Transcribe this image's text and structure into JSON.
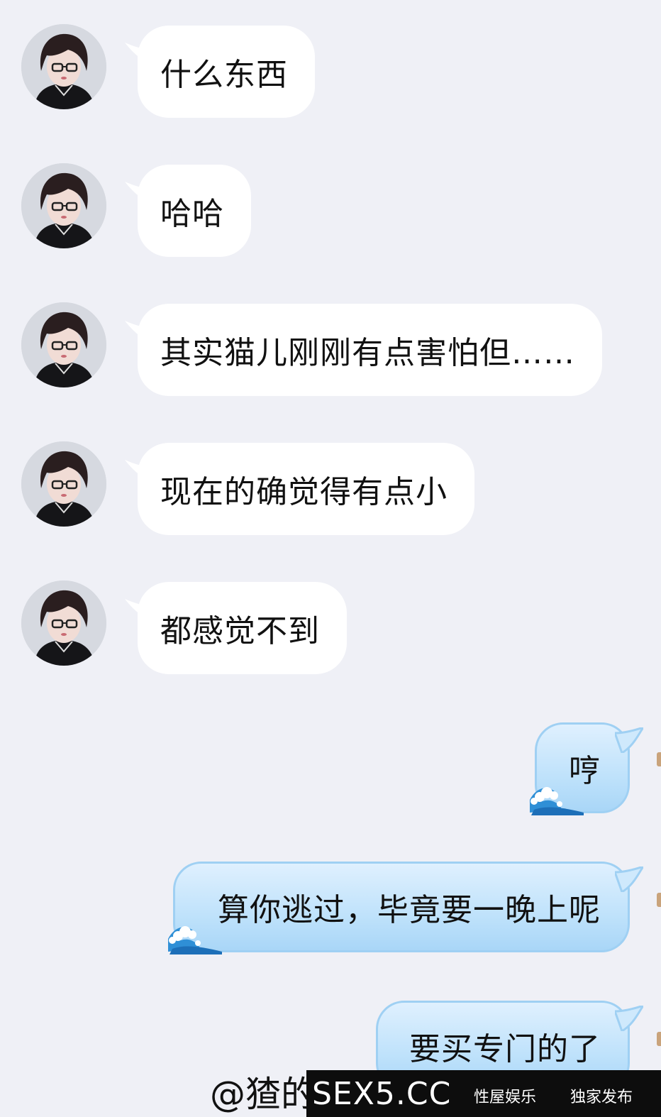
{
  "incoming_messages": [
    {
      "text": "什么东西"
    },
    {
      "text": "哈哈"
    },
    {
      "text": "其实猫儿刚刚有点害怕但……"
    },
    {
      "text": "现在的确觉得有点小"
    },
    {
      "text": "都感觉不到"
    }
  ],
  "outgoing_messages": [
    {
      "text": "哼"
    },
    {
      "text": "算你逃过，毕竟要一晚上呢"
    },
    {
      "text": "要买专门的了"
    }
  ],
  "watermark": {
    "handle": "@猹的"
  },
  "ad_bar": {
    "brand": "SEX5.CC",
    "tag1": "性屋娱乐",
    "tag2": "独家发布"
  },
  "colors": {
    "background": "#eff0f6",
    "incoming_bubble": "#ffffff",
    "outgoing_bubble": "#bfe2fb"
  },
  "icons": {
    "avatar": "user-avatar",
    "bubble_decoration": "wave-icon"
  }
}
